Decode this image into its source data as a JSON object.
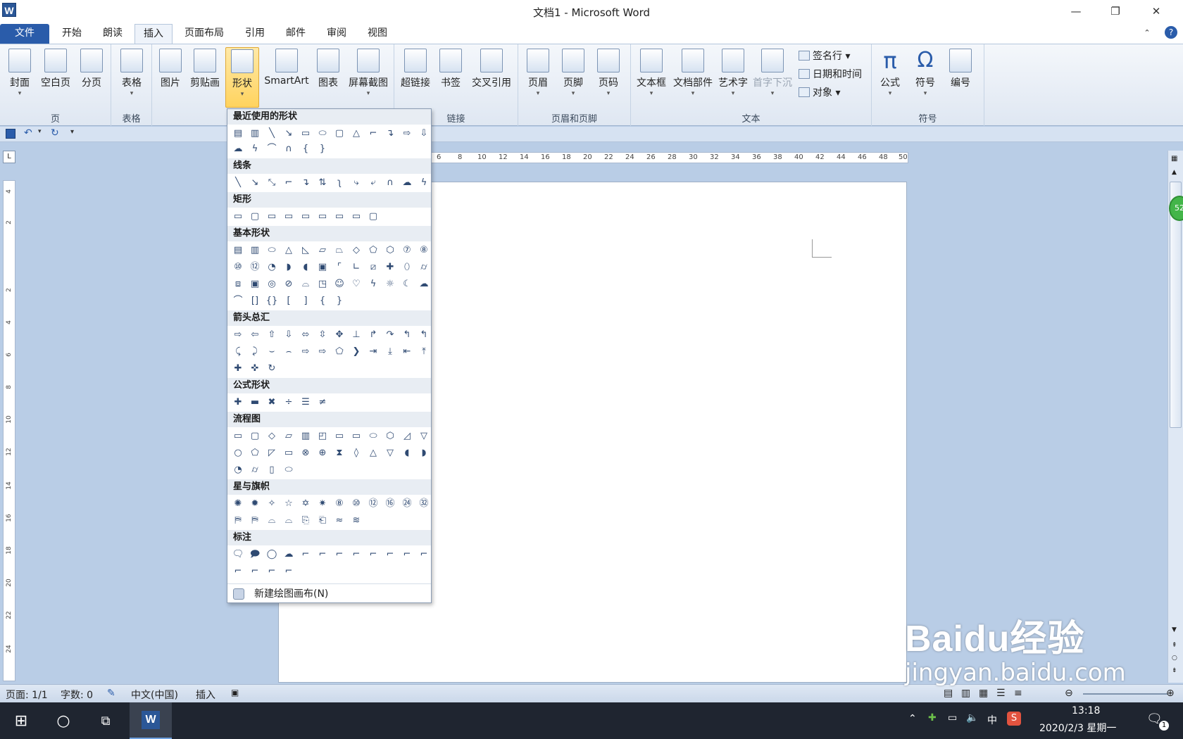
{
  "window": {
    "title": "文档1 - Microsoft Word",
    "app_icon": "W"
  },
  "tabs": [
    "文件",
    "开始",
    "朗读",
    "插入",
    "页面布局",
    "引用",
    "邮件",
    "审阅",
    "视图"
  ],
  "ribbon": {
    "page_group": {
      "label": "页",
      "buttons": [
        "封面",
        "空白页",
        "分页"
      ]
    },
    "table_group": {
      "label": "表格",
      "buttons": [
        "表格"
      ]
    },
    "illustrations": {
      "buttons": [
        "图片",
        "剪贴画",
        "形状",
        "SmartArt",
        "图表",
        "屏幕截图"
      ]
    },
    "links_group": {
      "label": "链接",
      "buttons": [
        "超链接",
        "书签",
        "交叉引用"
      ]
    },
    "header_group": {
      "label": "页眉和页脚",
      "buttons": [
        "页眉",
        "页脚",
        "页码"
      ]
    },
    "text_group": {
      "label": "文本",
      "buttons": [
        "文本框",
        "文档部件",
        "艺术字",
        "首字下沉"
      ],
      "small": [
        "签名行",
        "日期和时间",
        "对象"
      ]
    },
    "symbols_group": {
      "label": "符号",
      "buttons": [
        "公式",
        "符号",
        "编号"
      ]
    }
  },
  "shapes_menu": {
    "categories": [
      "最近使用的形状",
      "线条",
      "矩形",
      "基本形状",
      "箭头总汇",
      "公式形状",
      "流程图",
      "星与旗帜",
      "标注"
    ],
    "new_canvas": "新建绘图画布(N)"
  },
  "ruler": {
    "h_labels": [
      "6",
      "8",
      "10",
      "12",
      "14",
      "16",
      "18",
      "20",
      "22",
      "24",
      "26",
      "28",
      "30",
      "32",
      "34",
      "36",
      "38",
      "40",
      "42",
      "44",
      "46",
      "48",
      "50"
    ],
    "v_labels": [
      "4",
      "2",
      "2",
      "4",
      "6",
      "8",
      "10",
      "12",
      "14",
      "16",
      "18",
      "20",
      "22",
      "24"
    ]
  },
  "status": {
    "page": "页面: 1/1",
    "words": "字数: 0",
    "language": "中文(中国)",
    "mode": "插入"
  },
  "taskbar": {
    "time": "13:18",
    "date": "2020/2/3 星期一",
    "ime": "中",
    "notif": "1"
  },
  "watermark": {
    "main": "Baidu经验",
    "sub": "jingyan.baidu.com"
  },
  "badge": "52"
}
